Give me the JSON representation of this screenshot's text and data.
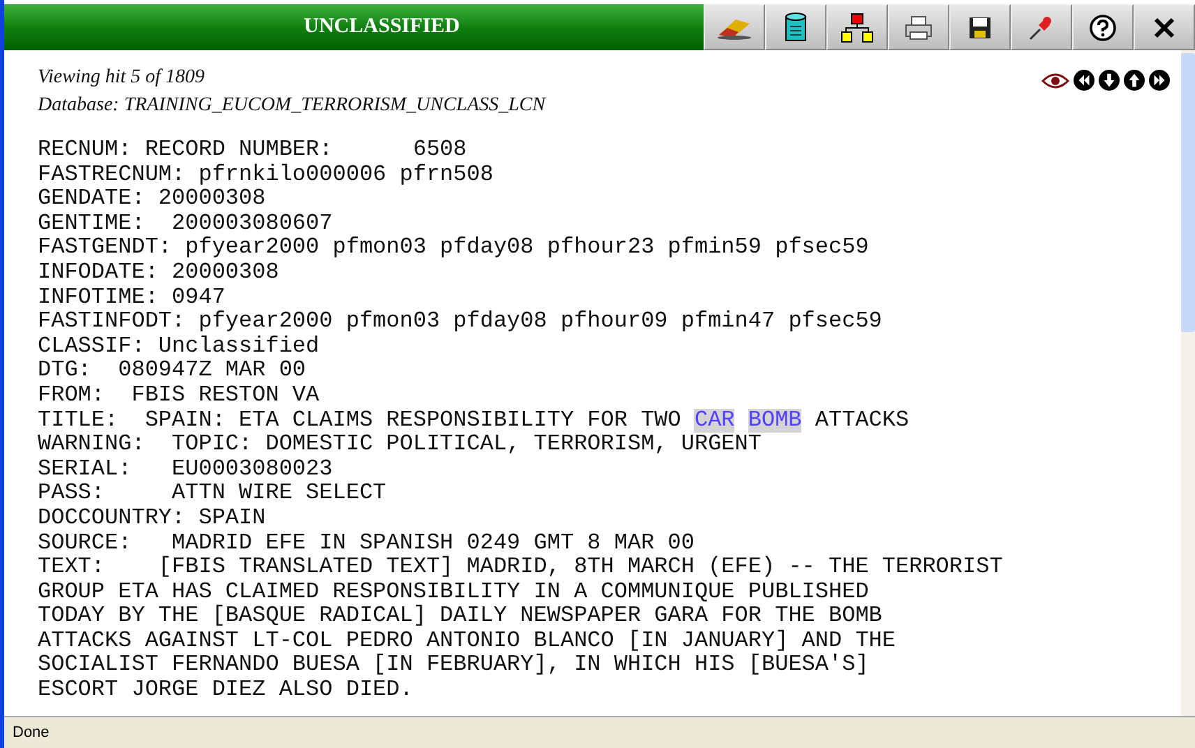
{
  "title_bar": {
    "title": "UNCLASSIFIED"
  },
  "toolbar": {
    "buttons": [
      {
        "kind": "eraser"
      },
      {
        "kind": "database"
      },
      {
        "kind": "tree"
      },
      {
        "kind": "printer"
      },
      {
        "kind": "save"
      },
      {
        "kind": "pin"
      },
      {
        "kind": "help"
      },
      {
        "kind": "close"
      }
    ]
  },
  "header": {
    "hit_info": "Viewing hit 5 of 1809",
    "database": "Database: TRAINING_EUCOM_TERRORISM_UNCLASS_LCN",
    "nav": [
      {
        "kind": "view"
      },
      {
        "kind": "first"
      },
      {
        "kind": "next"
      },
      {
        "kind": "previous"
      },
      {
        "kind": "last"
      }
    ]
  },
  "record_lines": [
    {
      "parts": [
        {
          "text": "RECNUM: RECORD NUMBER:      6508",
          "highlighted": false
        }
      ]
    },
    {
      "parts": [
        {
          "text": "FASTRECNUM: pfrnkilo000006 pfrn508",
          "highlighted": false
        }
      ]
    },
    {
      "parts": [
        {
          "text": "GENDATE: 20000308",
          "highlighted": false
        }
      ]
    },
    {
      "parts": [
        {
          "text": "GENTIME:  200003080607",
          "highlighted": false
        }
      ]
    },
    {
      "parts": [
        {
          "text": "FASTGENDT: pfyear2000 pfmon03 pfday08 pfhour23 pfmin59 pfsec59",
          "highlighted": false
        }
      ]
    },
    {
      "parts": [
        {
          "text": "INFODATE: 20000308",
          "highlighted": false
        }
      ]
    },
    {
      "parts": [
        {
          "text": "INFOTIME: 0947",
          "highlighted": false
        }
      ]
    },
    {
      "parts": [
        {
          "text": "FASTINFODT: pfyear2000 pfmon03 pfday08 pfhour09 pfmin47 pfsec59",
          "highlighted": false
        }
      ]
    },
    {
      "parts": [
        {
          "text": "CLASSIF: Unclassified",
          "highlighted": false
        }
      ]
    },
    {
      "parts": [
        {
          "text": "DTG:  080947Z MAR 00",
          "highlighted": false
        }
      ]
    },
    {
      "parts": [
        {
          "text": "FROM:  FBIS RESTON VA",
          "highlighted": false
        }
      ]
    },
    {
      "parts": [
        {
          "text": "TITLE:  SPAIN: ETA CLAIMS RESPONSIBILITY FOR TWO",
          "highlighted": false
        },
        {
          "text": "CAR",
          "highlighted": true
        },
        {
          "text": "BOMB",
          "highlighted": true
        },
        {
          "text": "ATTACKS",
          "highlighted": false
        }
      ]
    },
    {
      "parts": [
        {
          "text": "WARNING:  TOPIC: DOMESTIC POLITICAL, TERRORISM, URGENT",
          "highlighted": false
        }
      ]
    },
    {
      "parts": [
        {
          "text": "SERIAL:   EU0003080023",
          "highlighted": false
        }
      ]
    },
    {
      "parts": [
        {
          "text": "PASS:     ATTN WIRE SELECT",
          "highlighted": false
        }
      ]
    },
    {
      "parts": [
        {
          "text": "DOCCOUNTRY: SPAIN",
          "highlighted": false
        }
      ]
    },
    {
      "parts": [
        {
          "text": "SOURCE:   MADRID EFE IN SPANISH 0249 GMT 8 MAR 00",
          "highlighted": false
        }
      ]
    },
    {
      "parts": [
        {
          "text": "TEXT:    [FBIS TRANSLATED TEXT] MADRID, 8TH MARCH (EFE) -- THE TERRORIST",
          "highlighted": false
        }
      ]
    },
    {
      "parts": [
        {
          "text": "GROUP ETA HAS CLAIMED RESPONSIBILITY IN A COMMUNIQUE PUBLISHED",
          "highlighted": false
        }
      ]
    },
    {
      "parts": [
        {
          "text": "TODAY BY THE [BASQUE RADICAL] DAILY NEWSPAPER GARA FOR THE BOMB",
          "highlighted": false
        }
      ]
    },
    {
      "parts": [
        {
          "text": "ATTACKS AGAINST LT-COL PEDRO ANTONIO BLANCO [IN JANUARY] AND THE",
          "highlighted": false
        }
      ]
    },
    {
      "parts": [
        {
          "text": "SOCIALIST FERNANDO BUESA [IN FEBRUARY], IN WHICH HIS [BUESA'S]",
          "highlighted": false
        }
      ]
    },
    {
      "parts": [
        {
          "text": "ESCORT JORGE DIEZ ALSO DIED.",
          "highlighted": false
        }
      ]
    }
  ],
  "status_bar": {
    "text": "Done"
  }
}
